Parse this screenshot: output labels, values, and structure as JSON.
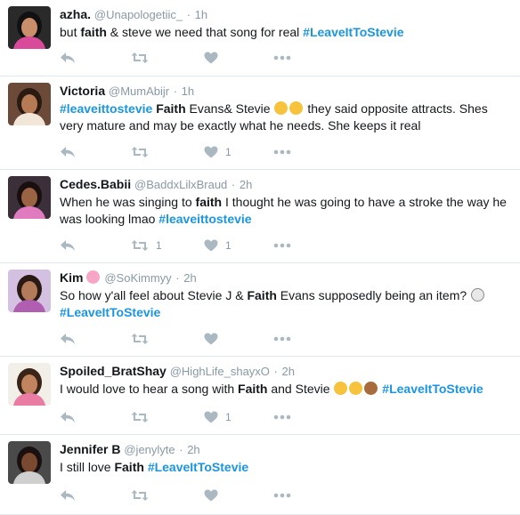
{
  "tweets": [
    {
      "name": "azha.",
      "handle": "@Unapologetiic_",
      "time": "1h",
      "segments": [
        {
          "t": "but "
        },
        {
          "t": "faith",
          "b": true
        },
        {
          "t": " & steve we need that song for real "
        },
        {
          "t": "#LeaveItToStevie",
          "tag": true
        }
      ],
      "retweets": "",
      "likes": ""
    },
    {
      "name": "Victoria",
      "handle": "@MumAbijr",
      "time": "1h",
      "segments": [
        {
          "t": "#leaveittostevie",
          "tag": true
        },
        {
          "t": " "
        },
        {
          "t": "Faith",
          "b": true
        },
        {
          "t": " Evans& Stevie "
        },
        {
          "emoji": "thinking-face"
        },
        {
          "emoji": "thinking-face"
        },
        {
          "t": " they said opposite attracts. Shes very mature and may be exactly what he needs. She keeps it real"
        }
      ],
      "retweets": "",
      "likes": "1"
    },
    {
      "name": "Cedes.Babii",
      "handle": "@BaddxLilxBraud",
      "time": "2h",
      "segments": [
        {
          "t": "When he was singing to "
        },
        {
          "t": "faith",
          "b": true
        },
        {
          "t": " I thought he was going to have a stroke the way he was looking lmao "
        },
        {
          "t": "#leaveittostevie",
          "tag": true
        }
      ],
      "retweets": "1",
      "likes": "1"
    },
    {
      "name": "Kim",
      "name_emoji": "cherry-blossom",
      "handle": "@SoKimmyy",
      "time": "2h",
      "segments": [
        {
          "t": "So how y'all feel about Stevie J & "
        },
        {
          "t": "Faith",
          "b": true
        },
        {
          "t": " Evans supposedly being an item? "
        },
        {
          "emoji": "eyes"
        },
        {
          "t": " "
        },
        {
          "t": "#LeaveItToStevie",
          "tag": true
        }
      ],
      "retweets": "",
      "likes": ""
    },
    {
      "name": "Spoiled_BratShay",
      "handle": "@HighLife_shayxO",
      "time": "2h",
      "segments": [
        {
          "t": "I would love to hear a song with "
        },
        {
          "t": "Faith",
          "b": true
        },
        {
          "t": " and Stevie "
        },
        {
          "emoji": "grimacing-face"
        },
        {
          "emoji": "heart-eyes"
        },
        {
          "emoji": "raised-hands"
        },
        {
          "t": " "
        },
        {
          "t": "#LeaveItToStevie",
          "tag": true
        }
      ],
      "retweets": "",
      "likes": "1"
    },
    {
      "name": "Jennifer B",
      "handle": "@jenylyte",
      "time": "2h",
      "segments": [
        {
          "t": "I still love "
        },
        {
          "t": "Faith",
          "b": true
        },
        {
          "t": " "
        },
        {
          "t": "#LeaveItToStevie",
          "tag": true
        }
      ],
      "retweets": "",
      "likes": ""
    }
  ],
  "colors": {
    "hashtag": "#1b95e0",
    "meta": "#8899a6",
    "icon": "#aab8c2",
    "divider": "#e1e8ed"
  }
}
